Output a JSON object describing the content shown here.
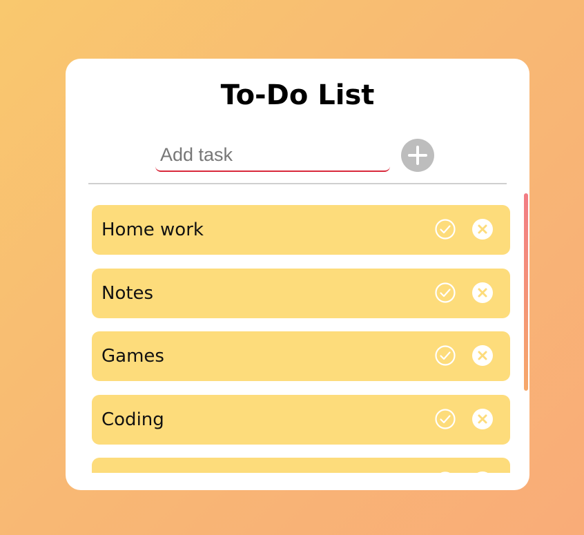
{
  "app": {
    "title": "To-Do List"
  },
  "input": {
    "placeholder": "Add task",
    "value": ""
  },
  "tasks": [
    {
      "label": "Home work"
    },
    {
      "label": "Notes"
    },
    {
      "label": "Games"
    },
    {
      "label": "Coding"
    },
    {
      "label": ""
    }
  ],
  "colors": {
    "card_bg": "#ffffff",
    "task_bg": "#fddc7b",
    "input_underline": "#d8283a",
    "add_button": "#bdbdbd",
    "scroll_thumb_top": "#f27c84",
    "scroll_thumb_bottom": "#f6a86a"
  },
  "icons": {
    "add": "plus-icon",
    "complete": "check-circle-icon",
    "delete": "x-circle-icon"
  }
}
